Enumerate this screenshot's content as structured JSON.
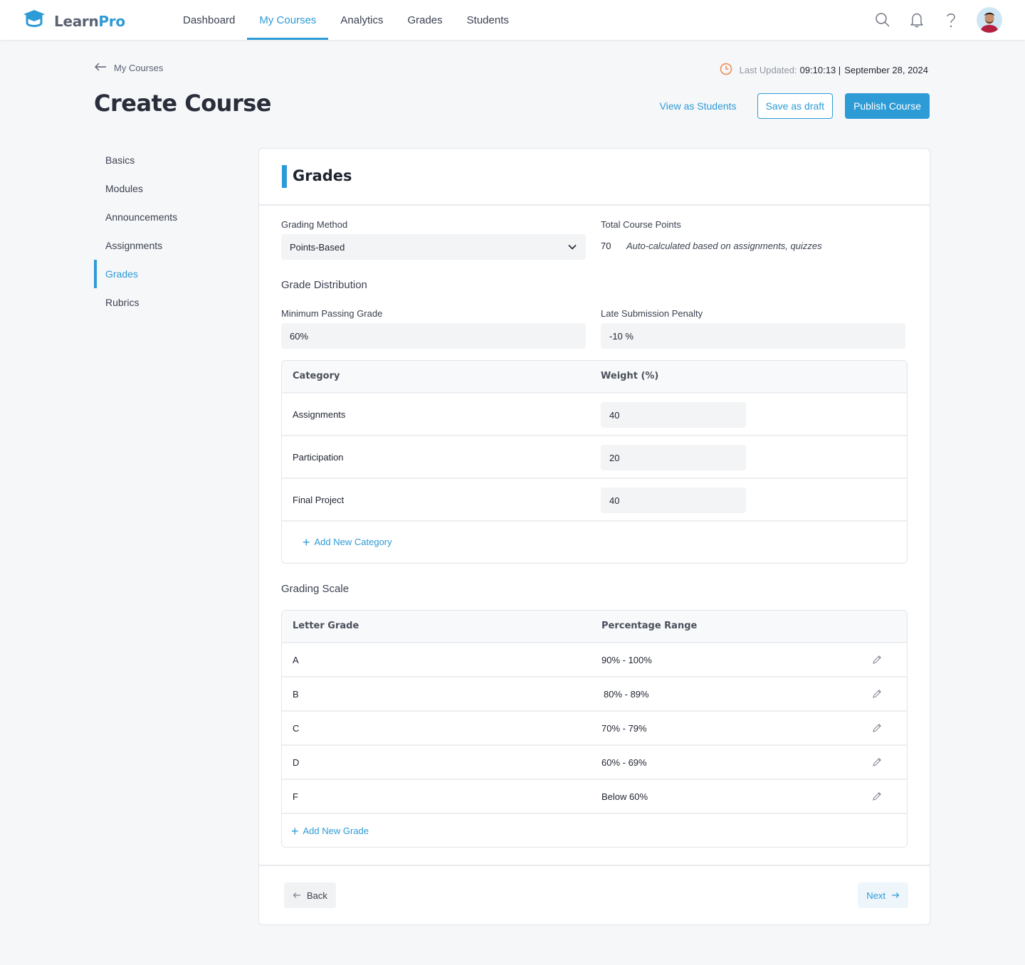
{
  "app": {
    "name_part1": "Learn",
    "name_part2": "Pro",
    "brand_color": "#2d9bd6"
  },
  "nav": {
    "items": [
      {
        "label": "Dashboard",
        "active": false
      },
      {
        "label": "My Courses",
        "active": true
      },
      {
        "label": "Analytics",
        "active": false
      },
      {
        "label": "Grades",
        "active": false
      },
      {
        "label": "Students",
        "active": false
      }
    ],
    "icons": [
      "search-icon",
      "bell-icon",
      "help-icon",
      "avatar"
    ]
  },
  "header": {
    "breadcrumb": "My Courses",
    "title": "Create Course",
    "last_updated_label": "Last Updated:",
    "last_updated_time": "09:10:13 |",
    "last_updated_date": "September 28, 2024",
    "view_as_students": "View as Students",
    "save_draft": "Save as draft",
    "publish": "Publish Course"
  },
  "sidebar": {
    "items": [
      {
        "label": "Basics",
        "active": false
      },
      {
        "label": "Modules",
        "active": false
      },
      {
        "label": "Announcements",
        "active": false
      },
      {
        "label": "Assignments",
        "active": false
      },
      {
        "label": "Grades",
        "active": true
      },
      {
        "label": "Rubrics",
        "active": false
      }
    ]
  },
  "grades": {
    "title": "Grades",
    "grading_method_label": "Grading Method",
    "grading_method_value": "Points-Based",
    "total_points_label": "Total Course Points",
    "total_points_value": "70",
    "total_points_note": "Auto-calculated based on assignments, quizzes",
    "distribution_title": "Grade Distribution",
    "min_passing_label": "Minimum Passing Grade",
    "min_passing_value": "60%",
    "late_penalty_label": "Late Submission Penalty",
    "late_penalty_value": "-10 %",
    "category_table": {
      "headers": [
        "Category",
        "Weight (%)"
      ],
      "rows": [
        {
          "category": "Assignments",
          "weight": "40"
        },
        {
          "category": "Participation",
          "weight": "20"
        },
        {
          "category": "Final Project",
          "weight": "40"
        }
      ],
      "add_label": "Add New Category"
    },
    "scale_title": "Grading Scale",
    "scale_table": {
      "headers": [
        "Letter Grade",
        "Percentage Range"
      ],
      "rows": [
        {
          "grade": "A",
          "range": "90% - 100%"
        },
        {
          "grade": "B",
          "range": "80% - 89%"
        },
        {
          "grade": "C",
          "range": "70% - 79%"
        },
        {
          "grade": "D",
          "range": "60% - 69%"
        },
        {
          "grade": "F",
          "range": "Below 60%"
        }
      ],
      "add_label": "Add New Grade"
    },
    "back_label": "Back",
    "next_label": "Next"
  }
}
